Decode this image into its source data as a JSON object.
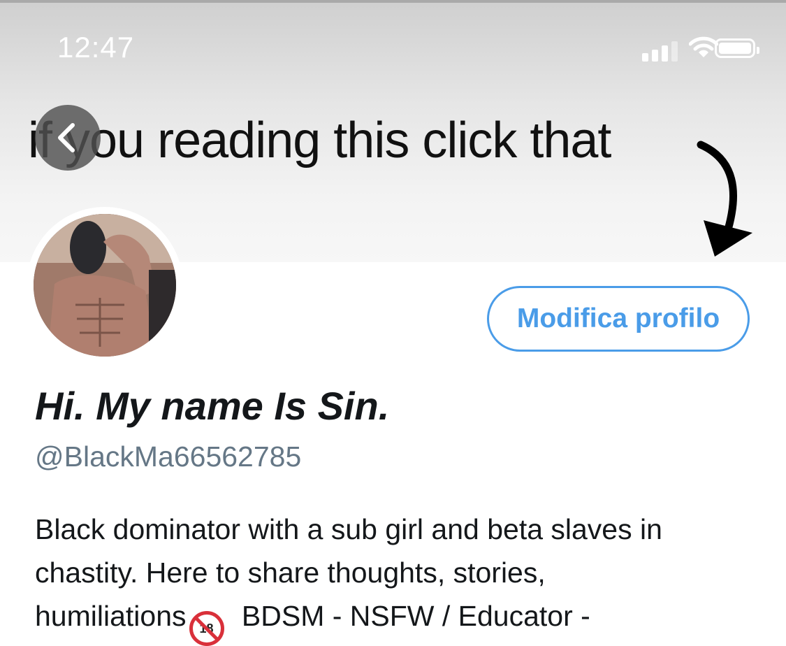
{
  "status_bar": {
    "time": "12:47"
  },
  "banner": {
    "text": "if you reading this click that"
  },
  "profile": {
    "edit_button_label": "Modifica profilo",
    "display_name": "Hi. My name Is Sin.",
    "handle": "@BlackMa66562785",
    "bio_lines": [
      "Black dominator with a sub girl and beta slaves in",
      "chastity. Here to share thoughts, stories,",
      "humiliations"
    ],
    "bio_line3_rest": " BDSM - NSFW / Educator -",
    "bio_badge_icon": "no-one-under-eighteen-icon",
    "bio_badge_text": "18"
  },
  "colors": {
    "accent": "#4a9ce8",
    "text": "#14171a",
    "secondary_text": "#657786"
  }
}
